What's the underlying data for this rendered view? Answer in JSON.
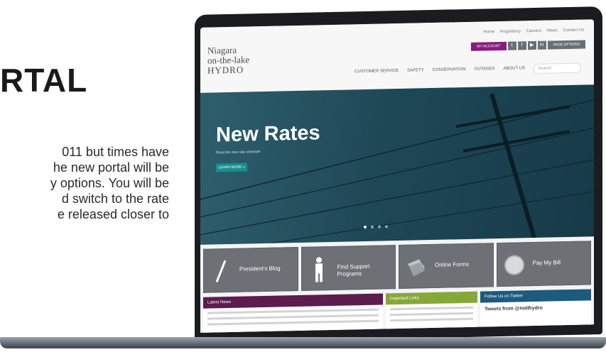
{
  "article": {
    "heading": "RTAL",
    "lines": [
      "011 but times have",
      "he new portal will be",
      "y options. You will be",
      "d switch to the rate",
      "e released closer to"
    ]
  },
  "site": {
    "logo": {
      "line1": "Niagara",
      "line2": "on-the-lake",
      "line3": "HYDRO"
    },
    "top_links": [
      "Home",
      "Regulatory",
      "Careers",
      "News",
      "Contact Us"
    ],
    "account_button": "MY ACCOUNT",
    "social": [
      {
        "icon": "twitter-icon",
        "glyph": "t"
      },
      {
        "icon": "facebook-icon",
        "glyph": "f"
      },
      {
        "icon": "youtube-icon",
        "glyph": "▶"
      },
      {
        "icon": "linkedin-icon",
        "glyph": "in"
      }
    ],
    "dark_button": "PAGE OPTIONS",
    "nav": [
      "CUSTOMER SERVICE",
      "SAFETY",
      "CONSERVATION",
      "OUTAGES",
      "ABOUT US"
    ],
    "search_placeholder": "Search",
    "hero": {
      "title": "New Rates",
      "subtitle": "Read the new rate schedule",
      "button": "LEARN MORE »"
    },
    "tiles": [
      {
        "icon": "pen-icon",
        "label": "President's Blog"
      },
      {
        "icon": "person-icon",
        "label": "Find Support Programs"
      },
      {
        "icon": "forms-icon",
        "label": "Online Forms"
      },
      {
        "icon": "coin-icon",
        "label": "Pay My Bill"
      }
    ],
    "panels": {
      "latest_news": "Latest News",
      "important_links": "Important Links",
      "twitter_header": "Follow Us on Twitter",
      "twitter_body": "Tweets from @notlhydro"
    }
  },
  "colors": {
    "account": "#8a1b7e",
    "hero_button": "#178e8f",
    "news": "#5d1b4e",
    "links": "#86a838",
    "twitter": "#1d5a7d"
  }
}
